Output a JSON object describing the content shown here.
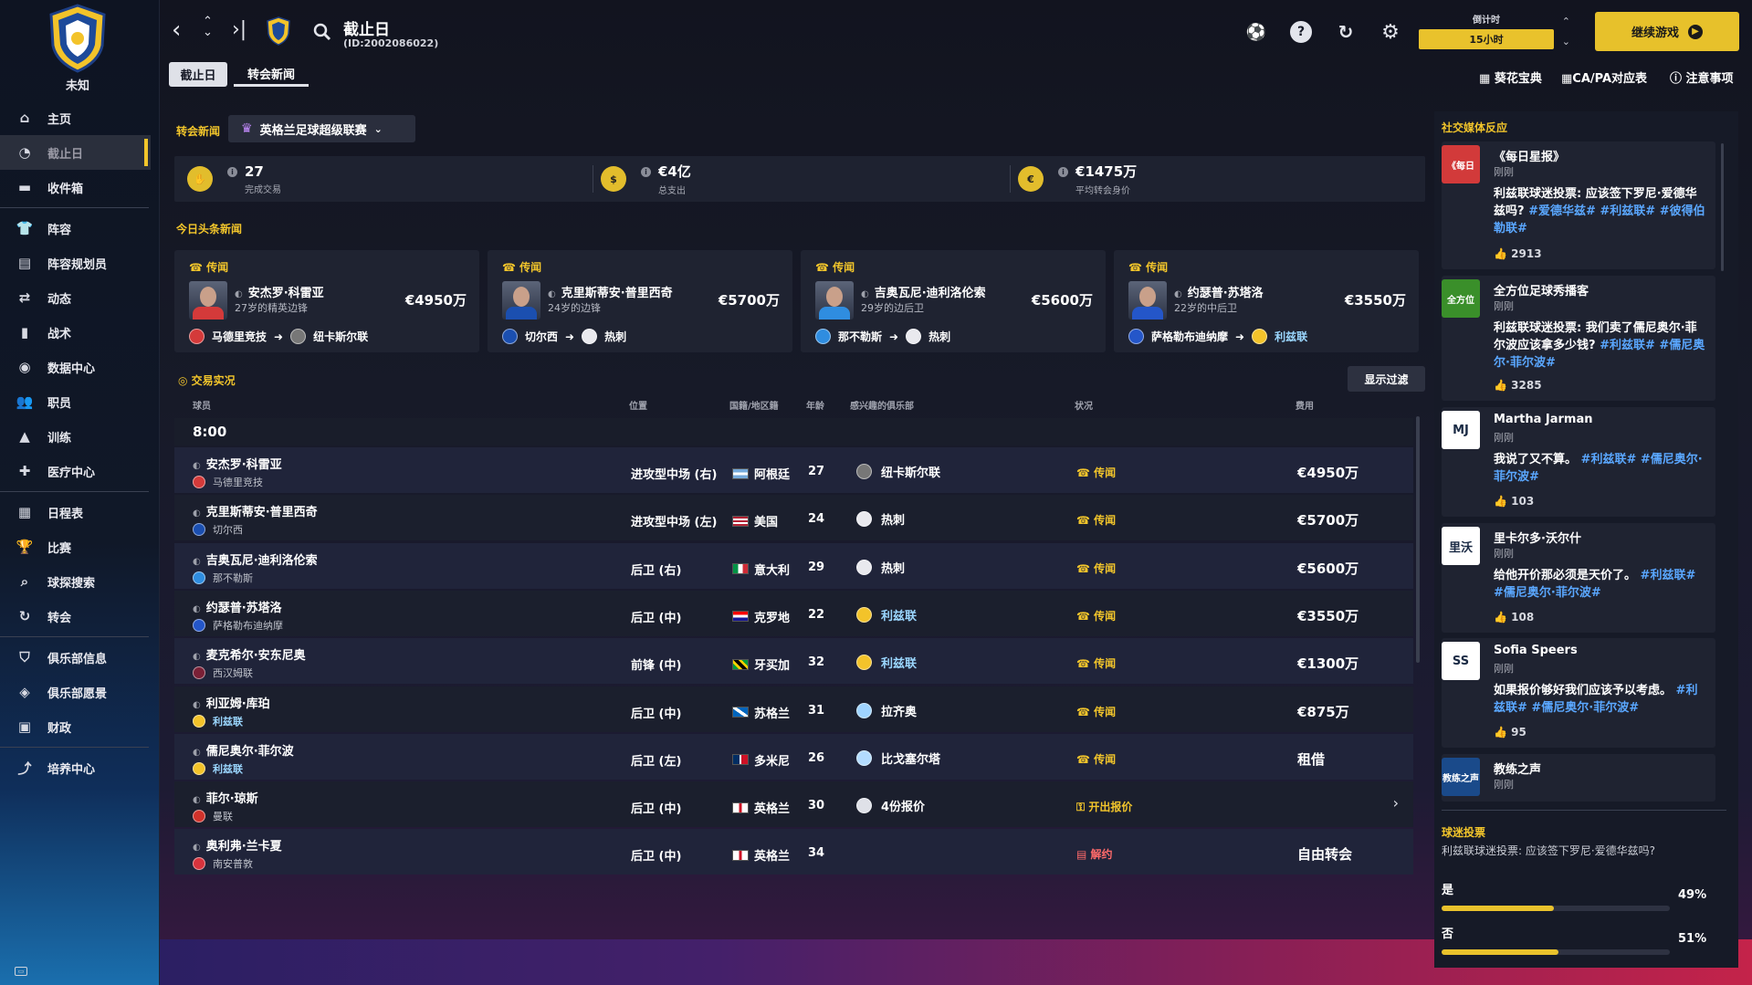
{
  "sidebar": {
    "club_label": "未知",
    "items": [
      {
        "label": "主页",
        "icon": "home-icon"
      },
      {
        "label": "截止日",
        "icon": "clock-icon",
        "active": true
      },
      {
        "label": "收件箱",
        "icon": "inbox-icon"
      },
      {
        "label": "阵容",
        "icon": "shirt-icon"
      },
      {
        "label": "阵容规划员",
        "icon": "clipboard-icon"
      },
      {
        "label": "动态",
        "icon": "dynamics-icon"
      },
      {
        "label": "战术",
        "icon": "tactics-icon"
      },
      {
        "label": "数据中心",
        "icon": "data-icon"
      },
      {
        "label": "职员",
        "icon": "staff-icon"
      },
      {
        "label": "训练",
        "icon": "training-icon"
      },
      {
        "label": "医疗中心",
        "icon": "medical-icon"
      },
      {
        "label": "日程表",
        "icon": "calendar-icon"
      },
      {
        "label": "比赛",
        "icon": "trophy-icon"
      },
      {
        "label": "球探搜索",
        "icon": "search-icon"
      },
      {
        "label": "转会",
        "icon": "transfer-icon"
      },
      {
        "label": "俱乐部信息",
        "icon": "shield-icon"
      },
      {
        "label": "俱乐部愿景",
        "icon": "vision-icon"
      },
      {
        "label": "财政",
        "icon": "money-icon"
      },
      {
        "label": "培养中心",
        "icon": "development-icon"
      }
    ]
  },
  "header": {
    "title": "截止日",
    "subtitle": "(ID:2002086022)",
    "tabs": [
      "截止日",
      "转会新闻"
    ],
    "countdown_label": "倒计时",
    "countdown_value": "15小时",
    "continue_label": "继续游戏",
    "links": [
      "葵花宝典",
      "CA/PA对应表",
      "注意事项"
    ]
  },
  "transfer_news": {
    "section_label": "转会新闻",
    "league": "英格兰足球超级联赛",
    "summary": [
      {
        "value": "27",
        "label": "完成交易"
      },
      {
        "value": "€4亿",
        "label": "总支出"
      },
      {
        "value": "€1475万",
        "label": "平均转会身价"
      }
    ]
  },
  "headlines": {
    "title": "今日头条新闻",
    "cards": [
      {
        "tag": "传闻",
        "name": "安杰罗·科雷亚",
        "desc": "27岁的精英边锋",
        "fee": "€4950万",
        "from": "马德里竞技",
        "to": "纽卡斯尔联",
        "to_leeds": false
      },
      {
        "tag": "传闻",
        "name": "克里斯蒂安·普里西奇",
        "desc": "24岁的边锋",
        "fee": "€5700万",
        "from": "切尔西",
        "to": "热刺",
        "to_leeds": false
      },
      {
        "tag": "传闻",
        "name": "吉奥瓦尼·迪利洛伦索",
        "desc": "29岁的边后卫",
        "fee": "€5600万",
        "from": "那不勒斯",
        "to": "热刺",
        "to_leeds": false
      },
      {
        "tag": "传闻",
        "name": "约瑟普·苏塔洛",
        "desc": "22岁的中后卫",
        "fee": "€3550万",
        "from": "萨格勒布迪纳摩",
        "to": "利兹联",
        "to_leeds": true
      }
    ]
  },
  "live": {
    "title": "交易实况",
    "filter_label": "显示过滤",
    "columns": [
      "球员",
      "位置",
      "国籍/地区籍",
      "年龄",
      "感兴趣的俱乐部",
      "状况",
      "费用"
    ],
    "time": "8:00",
    "rows": [
      {
        "name": "安杰罗·科雷亚",
        "club": "马德里竞技",
        "pos": "进攻型中场 (右)",
        "nat": "阿根廷",
        "age": "27",
        "interested": "纽卡斯尔联",
        "status": "传闻",
        "fee": "€4950万"
      },
      {
        "name": "克里斯蒂安·普里西奇",
        "club": "切尔西",
        "pos": "进攻型中场 (左)",
        "nat": "美国",
        "age": "24",
        "interested": "热刺",
        "status": "传闻",
        "fee": "€5700万"
      },
      {
        "name": "吉奥瓦尼·迪利洛伦索",
        "club": "那不勒斯",
        "pos": "后卫 (右)",
        "nat": "意大利",
        "age": "29",
        "interested": "热刺",
        "status": "传闻",
        "fee": "€5600万"
      },
      {
        "name": "约瑟普·苏塔洛",
        "club": "萨格勒布迪纳摩",
        "pos": "后卫 (中)",
        "nat": "克罗地",
        "age": "22",
        "interested": "利兹联",
        "status": "传闻",
        "fee": "€3550万"
      },
      {
        "name": "麦克希尔·安东尼奥",
        "club": "西汉姆联",
        "pos": "前锋 (中)",
        "nat": "牙买加",
        "age": "32",
        "interested": "利兹联",
        "status": "传闻",
        "fee": "€1300万"
      },
      {
        "name": "利亚姆·库珀",
        "club": "利兹联",
        "pos": "后卫 (中)",
        "nat": "苏格兰",
        "age": "31",
        "interested": "拉齐奥",
        "status": "传闻",
        "fee": "€875万"
      },
      {
        "name": "儒尼奥尔·菲尔波",
        "club": "利兹联",
        "pos": "后卫 (左)",
        "nat": "多米尼",
        "age": "26",
        "interested": "比戈塞尔塔",
        "status": "传闻",
        "fee": "租借"
      },
      {
        "name": "菲尔·琼斯",
        "club": "曼联",
        "pos": "后卫 (中)",
        "nat": "英格兰",
        "age": "30",
        "interested": "4份报价",
        "status": "开出报价",
        "fee": ""
      },
      {
        "name": "奥利弗·兰卡夏",
        "club": "南安普敦",
        "pos": "后卫 (中)",
        "nat": "英格兰",
        "age": "34",
        "interested": "",
        "status": "解约",
        "fee": "自由转会"
      }
    ]
  },
  "social": {
    "title": "社交媒体反应",
    "posts": [
      {
        "avatar": "《每日",
        "source": "《每日星报》",
        "time": "刚刚",
        "text": "利兹联球迷投票: 应该签下罗尼·爱德华兹吗?",
        "tags": "#爱德华兹# #利兹联# #彼得伯勒联#",
        "likes": "2913"
      },
      {
        "avatar": "全方位",
        "source": "全方位足球秀播客",
        "time": "刚刚",
        "text": "利兹联球迷投票: 我们卖了儒尼奥尔·菲尔波应该拿多少钱?",
        "tags": "#利兹联# #儒尼奥尔·菲尔波#",
        "likes": "3285"
      },
      {
        "avatar": "MJ",
        "source": "Martha Jarman",
        "time": "刚刚",
        "text": "我说了又不算。",
        "tags": "#利兹联# #儒尼奥尔·菲尔波#",
        "likes": "103"
      },
      {
        "avatar": "里沃",
        "source": "里卡尔多·沃尔什",
        "time": "刚刚",
        "text": "给他开价那必须是天价了。",
        "tags": "#利兹联# #儒尼奥尔·菲尔波#",
        "likes": "108"
      },
      {
        "avatar": "SS",
        "source": "Sofia Speers",
        "time": "刚刚",
        "text": "如果报价够好我们应该予以考虑。",
        "tags": "#利兹联# #儒尼奥尔·菲尔波#",
        "likes": "95"
      },
      {
        "avatar": "教练之声",
        "source": "教练之声",
        "time": "刚刚",
        "text": "",
        "tags": "",
        "likes": ""
      }
    ]
  },
  "poll": {
    "title": "球迷投票",
    "question": "利兹联球迷投票: 应该签下罗尼·爱德华兹吗?",
    "options": [
      {
        "label": "是",
        "pct": "49%",
        "value": 49
      },
      {
        "label": "否",
        "pct": "51%",
        "value": 51
      }
    ]
  }
}
